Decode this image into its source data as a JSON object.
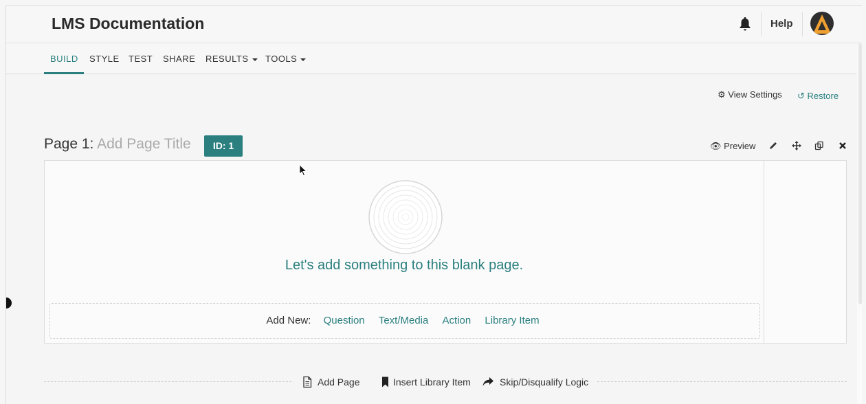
{
  "header": {
    "title": "LMS Documentation",
    "help_label": "Help"
  },
  "nav": {
    "build": "BUILD",
    "style": "STYLE",
    "test": "TEST",
    "share": "SHARE",
    "results": "RESULTS",
    "tools": "TOOLS"
  },
  "toolbar": {
    "view_settings": "View Settings",
    "restore": "Restore"
  },
  "page": {
    "label": "Page 1:",
    "title_placeholder": "Add Page Title",
    "id_badge": "ID: 1",
    "preview": "Preview",
    "blank_message": "Let's add something to this blank page.",
    "add_new_label": "Add New:",
    "add_options": [
      "Question",
      "Text/Media",
      "Action",
      "Library Item"
    ]
  },
  "footer_actions": {
    "add_page": "Add Page",
    "insert_library_item": "Insert Library Item",
    "skip_logic": "Skip/Disqualify Logic"
  },
  "colors": {
    "accent": "#2b7f7f",
    "placeholder": "#aaaaaa"
  }
}
